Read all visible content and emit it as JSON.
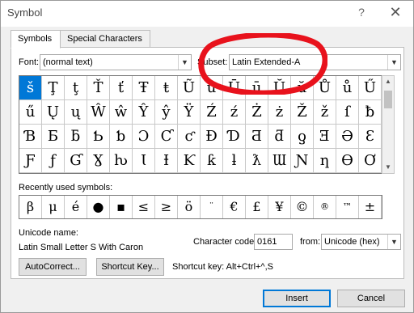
{
  "title": "Symbol",
  "titlebar": {
    "help": "?",
    "close": "✕"
  },
  "tabs": [
    {
      "label": "Symbols"
    },
    {
      "label": "Special Characters"
    }
  ],
  "font": {
    "label": "Font:",
    "value": "(normal text)"
  },
  "subset": {
    "label": "Subset:",
    "value": "Latin Extended-A"
  },
  "symbols": [
    [
      "š",
      "Ţ",
      "ţ",
      "Ť",
      "ť",
      "Ŧ",
      "ŧ",
      "Ũ",
      "ũ",
      "Ū",
      "ū",
      "Ŭ",
      "ŭ",
      "Ů",
      "ů",
      "Ű"
    ],
    [
      "ű",
      "Ų",
      "ų",
      "Ŵ",
      "ŵ",
      "Ŷ",
      "ŷ",
      "Ÿ",
      "Ź",
      "ź",
      "Ż",
      "ż",
      "Ž",
      "ž",
      "ſ",
      "ƀ"
    ],
    [
      "Ɓ",
      "Ƃ",
      "ƃ",
      "Ƅ",
      "ƅ",
      "Ɔ",
      "Ƈ",
      "ƈ",
      "Ɖ",
      "Ɗ",
      "Ƌ",
      "ƌ",
      "ƍ",
      "Ǝ",
      "Ə",
      "Ɛ"
    ],
    [
      "Ƒ",
      "ƒ",
      "Ɠ",
      "Ɣ",
      "ƕ",
      "Ɩ",
      "Ɨ",
      "Ƙ",
      "ƙ",
      "ƚ",
      "ƛ",
      "Ɯ",
      "Ɲ",
      "ƞ",
      "Ɵ",
      "Ơ"
    ]
  ],
  "recent": {
    "label": "Recently used symbols:",
    "items": [
      "β",
      "μ",
      "é",
      "●",
      "▪",
      "≤",
      "≥",
      "ö",
      "¨",
      "€",
      "£",
      "¥",
      "©",
      "®",
      "™",
      "±"
    ]
  },
  "unicode_name": {
    "label": "Unicode name:",
    "value": "Latin Small Letter S With Caron"
  },
  "character_code": {
    "label": "Character code:",
    "value": "0161"
  },
  "from": {
    "label": "from:",
    "value": "Unicode (hex)"
  },
  "buttons": {
    "autocorrect": "AutoCorrect...",
    "shortcut_key": "Shortcut Key...",
    "insert": "Insert",
    "cancel": "Cancel"
  },
  "shortcut_text": "Shortcut key: Alt+Ctrl+^,S",
  "colors": {
    "selection": "#0078d7",
    "annotation": "#e8121c"
  }
}
